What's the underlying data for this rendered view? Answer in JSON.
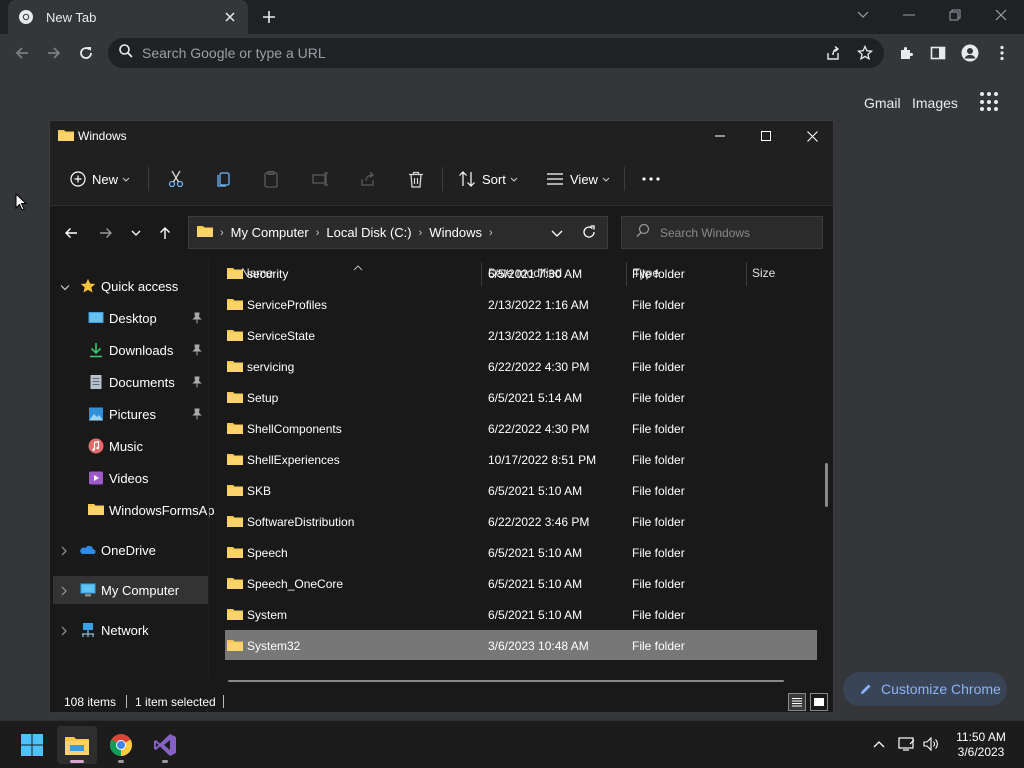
{
  "browser": {
    "tab_title": "New Tab",
    "omnibox_placeholder": "Search Google or type a URL",
    "ntp_links": [
      "Gmail",
      "Images"
    ],
    "customize_label": "Customize Chrome"
  },
  "explorer": {
    "window_title": "Windows",
    "commands": {
      "new_label": "New",
      "sort_label": "Sort",
      "view_label": "View"
    },
    "breadcrumb": [
      "My Computer",
      "Local Disk (C:)",
      "Windows"
    ],
    "search_placeholder": "Search Windows",
    "nav": {
      "quick_access": "Quick access",
      "pinned": [
        "Desktop",
        "Downloads",
        "Documents",
        "Pictures",
        "Music",
        "Videos",
        "WindowsFormsAp"
      ],
      "onedrive": "OneDrive",
      "my_computer": "My Computer",
      "network": "Network"
    },
    "columns": [
      "Name",
      "Date modified",
      "Type",
      "Size"
    ],
    "files": [
      {
        "name": "security",
        "date": "6/5/2021 7:30 AM",
        "type": "File folder"
      },
      {
        "name": "ServiceProfiles",
        "date": "2/13/2022 1:16 AM",
        "type": "File folder"
      },
      {
        "name": "ServiceState",
        "date": "2/13/2022 1:18 AM",
        "type": "File folder"
      },
      {
        "name": "servicing",
        "date": "6/22/2022 4:30 PM",
        "type": "File folder"
      },
      {
        "name": "Setup",
        "date": "6/5/2021 5:14 AM",
        "type": "File folder"
      },
      {
        "name": "ShellComponents",
        "date": "6/22/2022 4:30 PM",
        "type": "File folder"
      },
      {
        "name": "ShellExperiences",
        "date": "10/17/2022 8:51 PM",
        "type": "File folder"
      },
      {
        "name": "SKB",
        "date": "6/5/2021 5:10 AM",
        "type": "File folder"
      },
      {
        "name": "SoftwareDistribution",
        "date": "6/22/2022 3:46 PM",
        "type": "File folder"
      },
      {
        "name": "Speech",
        "date": "6/5/2021 5:10 AM",
        "type": "File folder"
      },
      {
        "name": "Speech_OneCore",
        "date": "6/5/2021 5:10 AM",
        "type": "File folder"
      },
      {
        "name": "System",
        "date": "6/5/2021 5:10 AM",
        "type": "File folder"
      },
      {
        "name": "System32",
        "date": "3/6/2023 10:48 AM",
        "type": "File folder",
        "selected": true
      }
    ],
    "status": {
      "item_count": "108 items",
      "selection": "1 item selected"
    }
  },
  "taskbar": {
    "time": "11:50 AM",
    "date": "3/6/2023"
  },
  "colors": {
    "folder": "#f8c948",
    "accent": "#8ab4f8",
    "selected_row": "#777777"
  }
}
